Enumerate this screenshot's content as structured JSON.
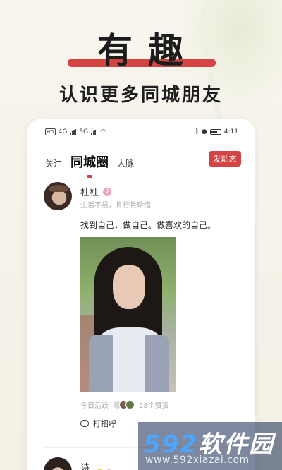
{
  "promo": {
    "title": "有趣",
    "subtitle": "认识更多同城朋友"
  },
  "statusbar": {
    "time": "4:11",
    "network1": "4G",
    "network2": "5G",
    "battery": "battery-icon"
  },
  "tabs": [
    {
      "label": "关注",
      "active": false
    },
    {
      "label": "同城圈",
      "active": true
    },
    {
      "label": "人脉",
      "active": false
    }
  ],
  "post_button": "发动态",
  "post": {
    "username": "杜杜",
    "bio": "生活不易，且行且珍惜",
    "text": "找到自己，做自己。做喜欢的自己。",
    "activity": "今日活跃",
    "likes": "28个赞赏",
    "greet": "打招呼"
  },
  "next_post": {
    "username": "诗宇"
  },
  "watermark": {
    "num": "592",
    "text": "软件园",
    "url": "www.592xiazai.com"
  },
  "colors": {
    "accent": "#d54444",
    "badge_pink": "#f2a0b8"
  }
}
